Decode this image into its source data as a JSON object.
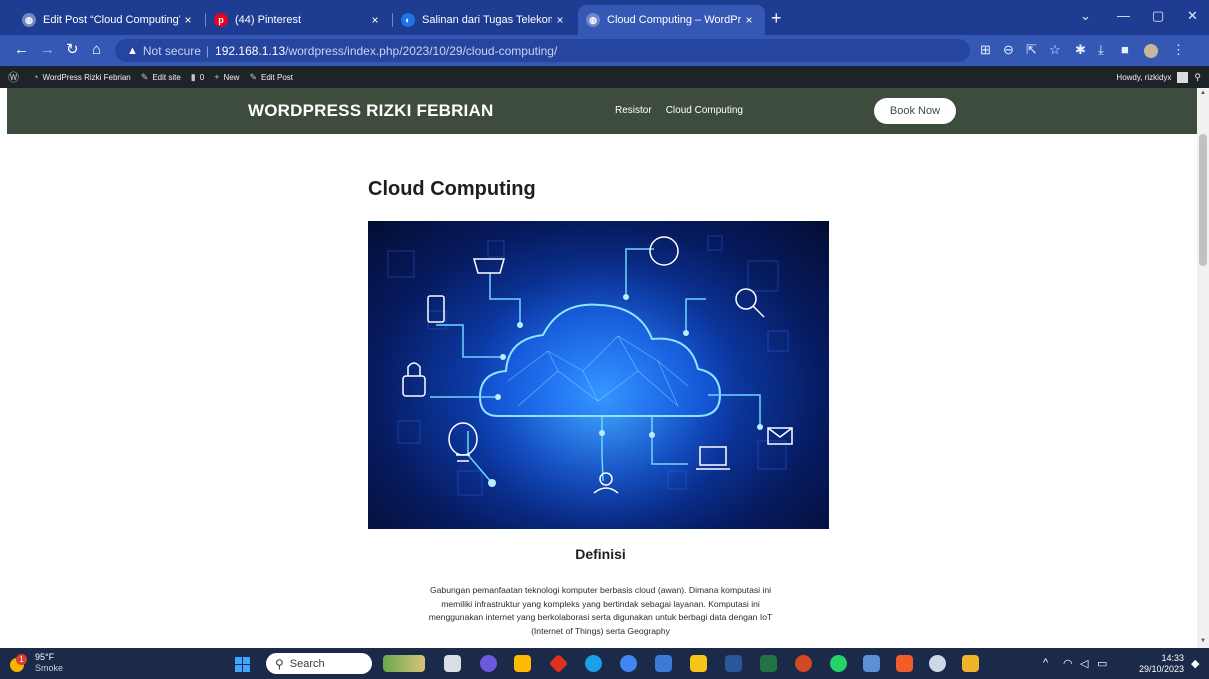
{
  "browser": {
    "tabs": [
      {
        "title": "Edit Post “Cloud Computing” ‹ W",
        "close": "×",
        "favicon": "globe-icon",
        "color": "#6f86c8"
      },
      {
        "title": "(44) Pinterest",
        "close": "×",
        "favicon": "pinterest-icon",
        "color": "#e60023"
      },
      {
        "title": "Salinan dari Tugas Telekomunika",
        "close": "×",
        "favicon": "docs-icon",
        "color": "#1a73e8"
      },
      {
        "title": "Cloud Computing – WordPress R",
        "close": "×",
        "favicon": "globe-icon",
        "color": "#6f86c8"
      }
    ],
    "new_tab": "+",
    "window_controls": [
      "⌄",
      "—",
      "▢",
      "✕"
    ],
    "security_label": "Not secure",
    "url_host": "192.168.1.13",
    "url_path": "/wordpress/index.php/2023/10/29/cloud-computing/"
  },
  "adminbar": {
    "site_name": "WordPress Rizki Febrian",
    "edit_site": "Edit site",
    "comments_count": "0",
    "new_label": "New",
    "edit_post": "Edit Post",
    "howdy": "Howdy, rizkidyx"
  },
  "site": {
    "title": "WORDPRESS RIZKI FEBRIAN",
    "menu": [
      "Resistor",
      "Cloud Computing"
    ],
    "cta": "Book Now"
  },
  "post": {
    "title": "Cloud Computing",
    "image_alt": "cloud-network-illustration",
    "heading": "Definisi",
    "paragraph_lines": [
      "Gabungan pemanfaatan teknologi komputer berbasis cloud (awan). Dimana komputasi ini",
      "memiliki infrastruktur yang kompleks yang bertindak sebagai layanan. Komputasi ini",
      "menggunakan internet yang berkolaborasi serta digunakan untuk berbagi data dengan IoT",
      "(Internet of Things) serta Geography"
    ]
  },
  "taskbar": {
    "weather_badge": "1",
    "temperature": "95°F",
    "condition": "Smoke",
    "search_placeholder": "Search",
    "time": "14:33",
    "date": "29/10/2023"
  },
  "colors": {
    "chrome_tabstrip": "#1f3c93",
    "chrome_toolbar": "#3558b5",
    "wp_adminbar": "#1d2327",
    "site_header": "#3e4c3e",
    "taskbar": "#1c2a4a"
  }
}
